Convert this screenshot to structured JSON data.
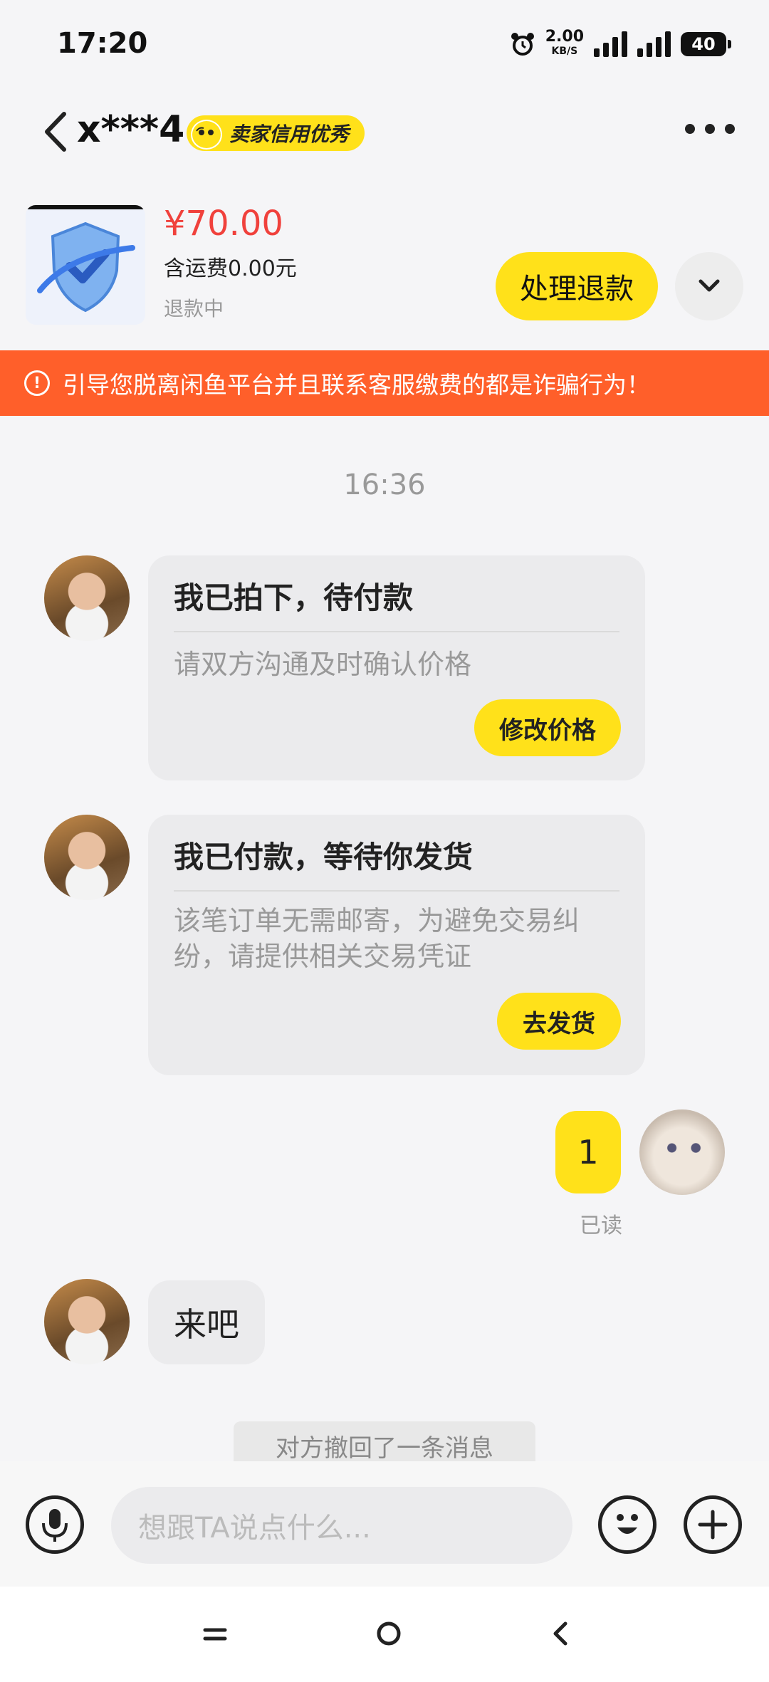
{
  "status_bar": {
    "time": "17:20",
    "speed_value": "2.00",
    "speed_unit": "KB/S",
    "battery": "40"
  },
  "header": {
    "title": "x***4",
    "badge": "卖家信用优秀"
  },
  "product": {
    "price": "¥70.00",
    "shipping": "含运费0.00元",
    "status": "退款中",
    "refund_button": "处理退款"
  },
  "warning": {
    "text": "引导您脱离闲鱼平台并且联系客服缴费的都是诈骗行为！"
  },
  "chat": {
    "timestamp": "16:36",
    "card1": {
      "title": "我已拍下，待付款",
      "desc": "请双方沟通及时确认价格",
      "button": "修改价格"
    },
    "card2": {
      "title": "我已付款，等待你发货",
      "desc": "该笔订单无需邮寄，为避免交易纠纷，请提供相关交易凭证",
      "button": "去发货"
    },
    "my_message": "1",
    "read_status": "已读",
    "their_message": "来吧",
    "recalled": "对方撤回了一条消息"
  },
  "input": {
    "placeholder": "想跟TA说点什么..."
  },
  "colors": {
    "accent": "#ffe11a",
    "warning": "#ff5f2a",
    "price": "#f0413c"
  },
  "icons": [
    "back-arrow-icon",
    "more-icon",
    "chevron-down-icon",
    "warning-icon",
    "microphone-icon",
    "emoji-icon",
    "plus-icon",
    "nav-menu-icon",
    "nav-home-icon",
    "nav-back-icon"
  ]
}
